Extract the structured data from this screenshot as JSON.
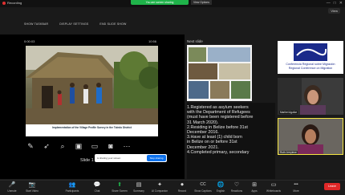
{
  "topbar": {
    "recording_label": "Recording",
    "share_banner": "You are screen sharing",
    "view_options": "View Options",
    "window_controls": [
      "—",
      "□",
      "✕"
    ],
    "view_button": "View"
  },
  "presenter": {
    "show_taskbar": "SHOW TASKBAR",
    "display_settings": "DISPLAY SETTINGS",
    "end_slide_show": "END SLIDE SHOW",
    "timer": "0:00:03",
    "clock": "10:56",
    "slide_label": "Slide 1",
    "caption": "Implementation of the Village Profile Survey in the Toledo District",
    "notification_text": "is sharing your screen",
    "stop_sharing": "Stop sharing",
    "next_slide_label": "Next slide",
    "notes": "1.Registered as asylum seekers\nwith the Department of Refugees\n(must have been registered before\n31 March 2020).\n2.Residing in Belize before 31st\nDecember 2016.\n3.Have at least (1) child born\nin Belize on or before 31st\nDecember 2021.\n4.Completed primary, secondary"
  },
  "participants": {
    "logo_line1": "Conferencia Regional sobre Migración",
    "logo_line2": "Regional Conference on Migration",
    "video1_name": "Maribel Aguilar",
    "video2_name": "Ruth Jerrylene"
  },
  "toolbar": [
    {
      "id": "unmute",
      "icon": "🎤",
      "label": "Unmute"
    },
    {
      "id": "start-video",
      "icon": "📷",
      "label": "Start Video"
    },
    {
      "id": "participants",
      "icon": "👥",
      "label": "Participants"
    },
    {
      "id": "chat",
      "icon": "💬",
      "label": "Chat"
    },
    {
      "id": "share-screen",
      "icon": "⬆",
      "label": "Share Screen"
    },
    {
      "id": "summary",
      "icon": "▤",
      "label": "Summary"
    },
    {
      "id": "ai-companion",
      "icon": "✦",
      "label": "AI Companion"
    },
    {
      "id": "record",
      "icon": "⏺",
      "label": "Record"
    },
    {
      "id": "show-captions",
      "icon": "CC",
      "label": "Show Captions"
    },
    {
      "id": "english",
      "icon": "🌐",
      "label": "English"
    },
    {
      "id": "reactions",
      "icon": "♡",
      "label": "Reactions"
    },
    {
      "id": "apps",
      "icon": "⊞",
      "label": "Apps"
    },
    {
      "id": "whiteboards",
      "icon": "▭",
      "label": "Whiteboards"
    },
    {
      "id": "more",
      "icon": "•••",
      "label": "More"
    }
  ],
  "leave_label": "Leave",
  "colors": {
    "accent": "#0e72ed",
    "share_green": "#1fb34a",
    "leave_red": "#e02828",
    "active_speaker": "#f4e542"
  }
}
